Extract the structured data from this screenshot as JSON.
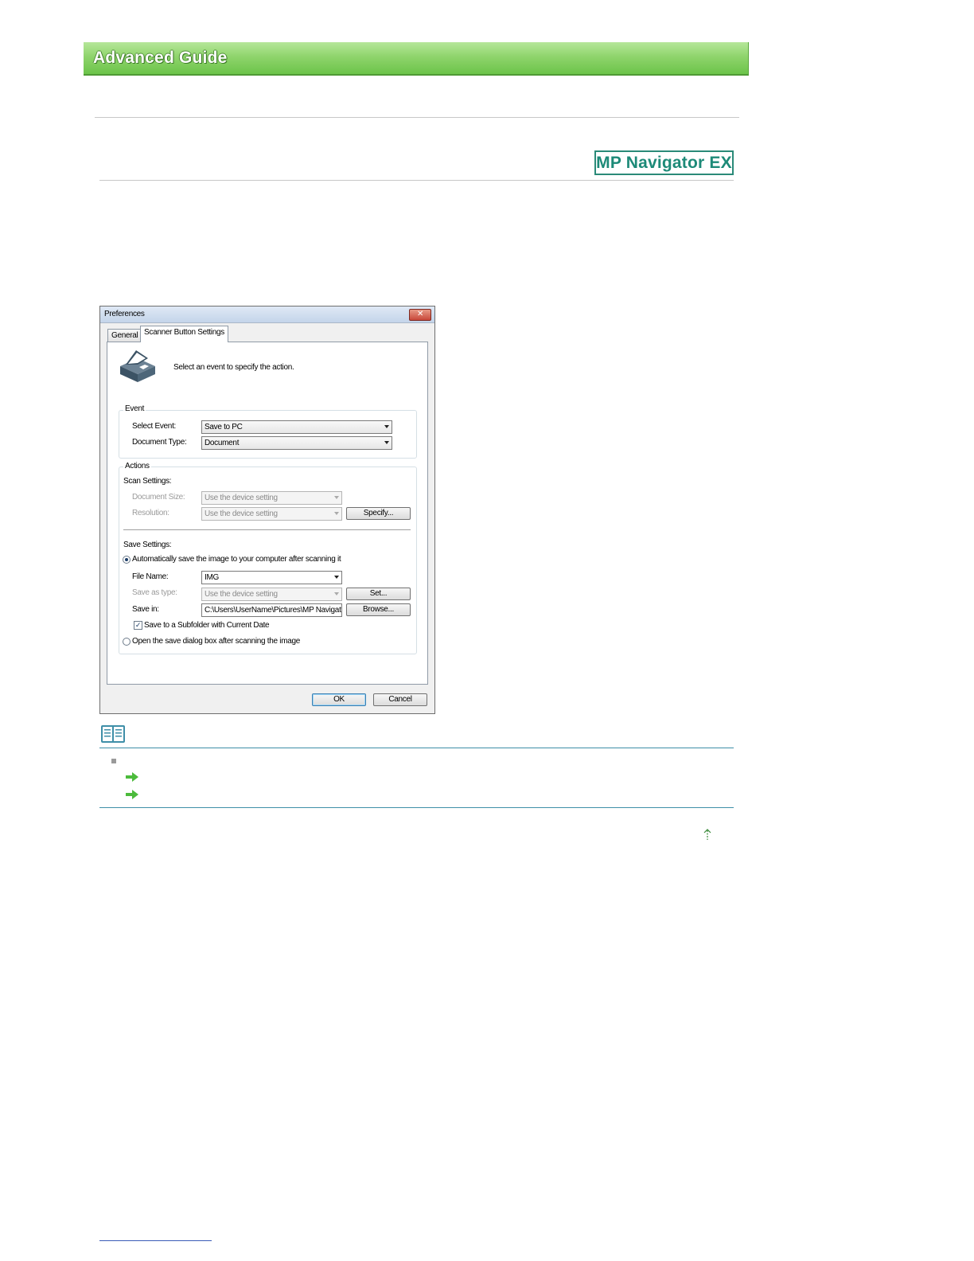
{
  "header": {
    "title": "Advanced Guide"
  },
  "badge": {
    "text": "MP Navigator EX"
  },
  "dialog": {
    "title": "Preferences",
    "close_label": "✕",
    "tabs": [
      {
        "label": "General"
      },
      {
        "label": "Scanner Button Settings"
      }
    ],
    "intro": "Select an event to specify the action.",
    "event": {
      "group_label": "Event",
      "select_event_label": "Select Event:",
      "select_event_value": "Save to PC",
      "document_type_label": "Document Type:",
      "document_type_value": "Document"
    },
    "actions": {
      "group_label": "Actions",
      "scan_settings_label": "Scan Settings:",
      "document_size_label": "Document Size:",
      "document_size_value": "Use the device setting",
      "resolution_label": "Resolution:",
      "resolution_value": "Use the device setting",
      "specify_button": "Specify...",
      "save_settings_label": "Save Settings:",
      "auto_save_label": "Automatically save the image to your computer after scanning it",
      "file_name_label": "File Name:",
      "file_name_value": "IMG",
      "save_as_type_label": "Save as type:",
      "save_as_type_value": "Use the device setting",
      "set_button": "Set...",
      "save_in_label": "Save in:",
      "save_in_value": "C:\\Users\\UserName\\Pictures\\MP Navigato",
      "browse_button": "Browse...",
      "subfolder_label": "Save to a Subfolder with Current Date",
      "subfolder_checked": true,
      "open_dialog_label": "Open the save dialog box after scanning the image"
    },
    "ok_button": "OK",
    "cancel_button": "Cancel"
  },
  "colors": {
    "banner_green": "#8fd46c",
    "badge_teal": "#1d8a78",
    "rule_teal": "#3f8fa8",
    "arrow_green": "#4cbb3c"
  }
}
